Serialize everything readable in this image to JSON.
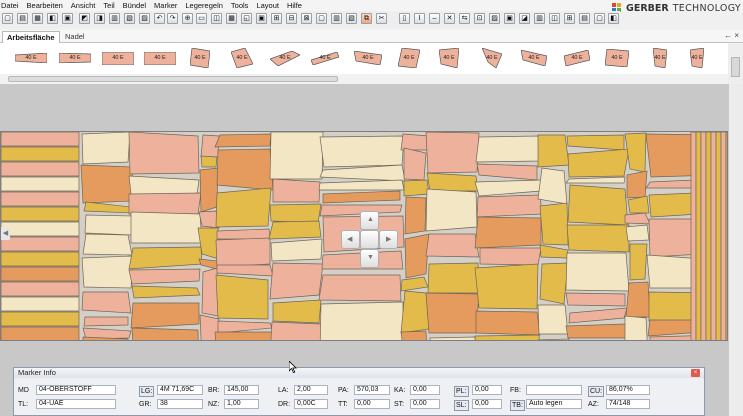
{
  "menu": [
    "Datei",
    "Bearbeiten",
    "Ansicht",
    "Teil",
    "Bündel",
    "Marker",
    "Legeregeln",
    "Tools",
    "Layout",
    "Hilfe"
  ],
  "brand": {
    "name": "GERBER",
    "suffix": "TECHNOLOGY"
  },
  "tabs": {
    "active": "Arbeitsfläche",
    "inactive": "Nadel"
  },
  "panel_controls": "← ×",
  "piece_label": "40 E",
  "marker_info": {
    "title": "Marker Info",
    "close": "×",
    "row1": [
      {
        "label": "MD",
        "value": "04-OBERSTOFF"
      },
      {
        "label": "LG:",
        "value": "4M 71,69C"
      },
      {
        "label": "BR:",
        "value": "145,00"
      },
      {
        "label": "LA:",
        "value": "2,00"
      },
      {
        "label": "PA:",
        "value": "570,03"
      },
      {
        "label": "KA:",
        "value": "0,00"
      },
      {
        "label": "PL:",
        "value": "0,00"
      },
      {
        "label": "FB:",
        "value": ""
      },
      {
        "label": "CU:",
        "value": "86,07%"
      }
    ],
    "row2": [
      {
        "label": "TL:",
        "value": "04-UAE"
      },
      {
        "label": "GR:",
        "value": "38"
      },
      {
        "label": "NZ:",
        "value": "1,00"
      },
      {
        "label": "DR:",
        "value": "0,00C"
      },
      {
        "label": "TT:",
        "value": "0,00"
      },
      {
        "label": "ST:",
        "value": "0,00"
      },
      {
        "label": "SL:",
        "value": "0,00"
      },
      {
        "label": "TB:",
        "value": "Auto legen"
      },
      {
        "label": "AZ:",
        "value": "74/148"
      }
    ]
  },
  "colors": {
    "pale": "#f3e6c4",
    "salmon": "#eeb29c",
    "orange": "#e59a5e",
    "mustard": "#e2bb4a",
    "background": "#d4cfc7"
  },
  "icons": [
    "new-icon",
    "open-icon",
    "save-icon",
    "print-icon",
    "undo-icon",
    "redo-icon",
    "zoom-icon",
    "rotate-icon",
    "flip-icon",
    "measure-icon"
  ]
}
